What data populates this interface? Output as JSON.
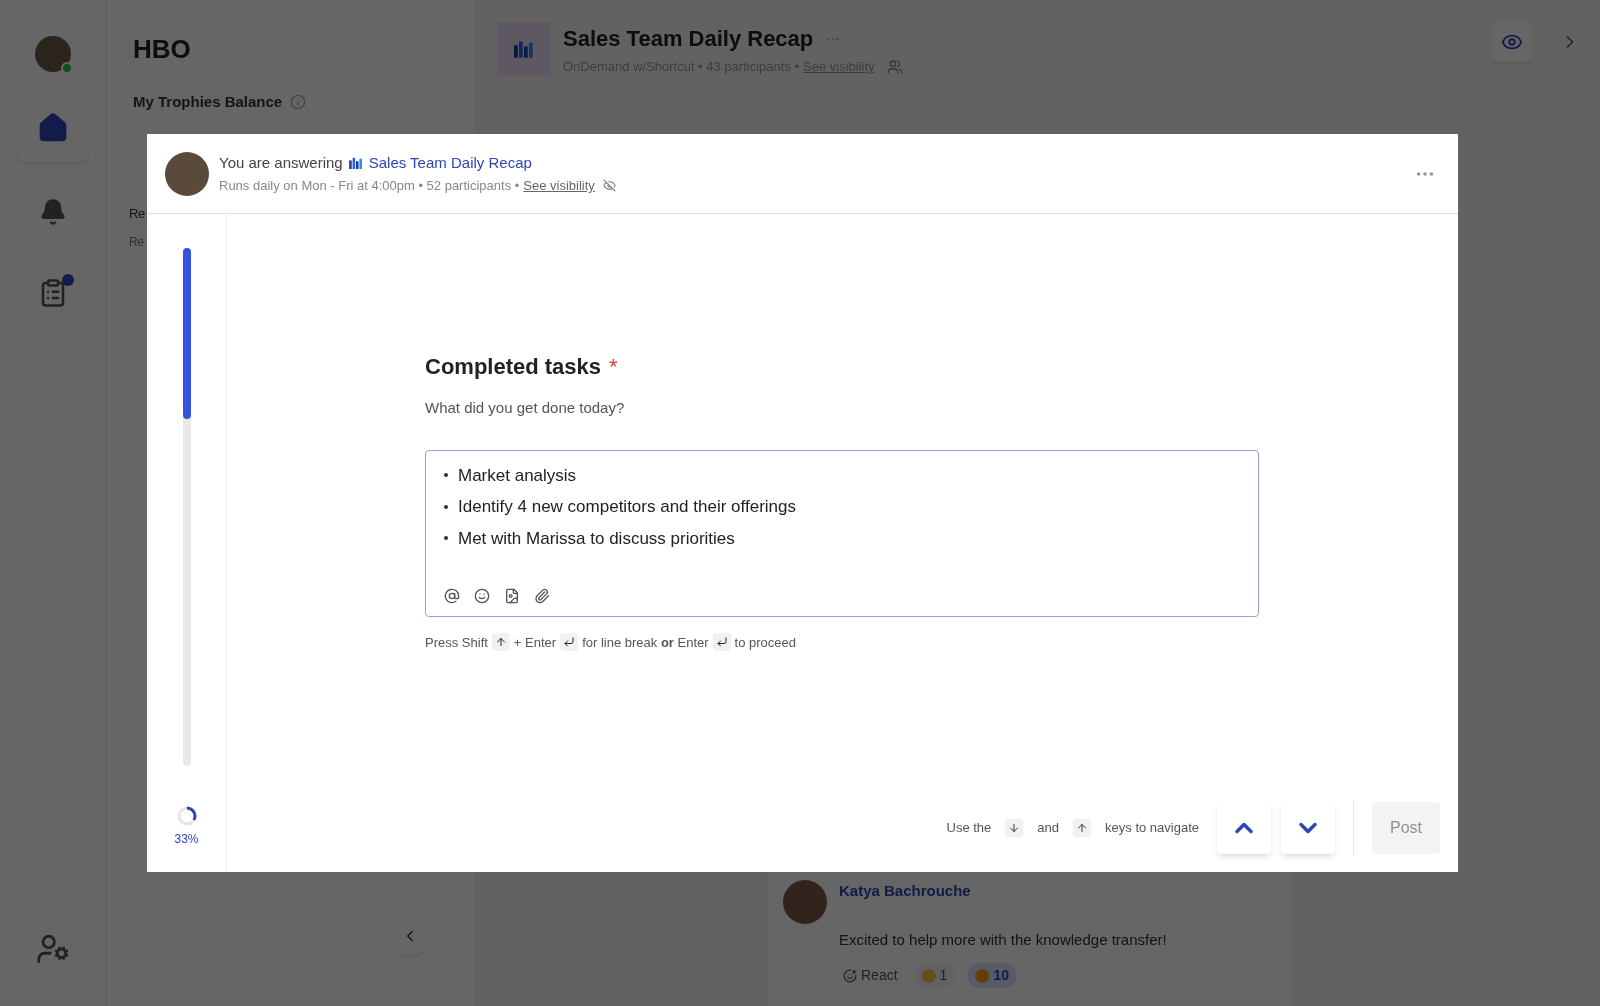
{
  "sidebar": {
    "title": "HBO",
    "trophies_label": "My Trophies Balance",
    "rows": [
      "Re",
      "Re"
    ]
  },
  "channel": {
    "title": "Sales Team Daily Recap",
    "meta": "OnDemand w/Shortcut • 43 participants •",
    "link": "See visibility"
  },
  "comment": {
    "author": "Katya Bachrouche",
    "text": "Excited to help more with the knowledge transfer!",
    "react": "React",
    "reactions": [
      {
        "count": "1",
        "selected": false
      },
      {
        "count": "10",
        "selected": true
      }
    ]
  },
  "modal": {
    "prefix": "You are answering",
    "survey": "Sales Team Daily Recap",
    "meta": "Runs daily on Mon - Fri at 4:00pm • 52 participants •",
    "link": "See visibility",
    "progress": {
      "level": 0.33,
      "reading": "33%"
    },
    "question": {
      "title": "Completed tasks",
      "required": true,
      "required_mark": "*",
      "description": "What did you get done today?"
    },
    "answer": [
      "Market analysis",
      "Identify 4 new competitors and their offerings",
      "Met with Marissa to discuss priorities"
    ],
    "hint": [
      "Press Shift",
      "+ Enter",
      "for line break **or** Enter",
      "to proceed"
    ],
    "nav_hint": [
      "Use the",
      "and",
      "keys to navigate"
    ],
    "post_button": {
      "label": "Post",
      "disabled": true
    }
  }
}
